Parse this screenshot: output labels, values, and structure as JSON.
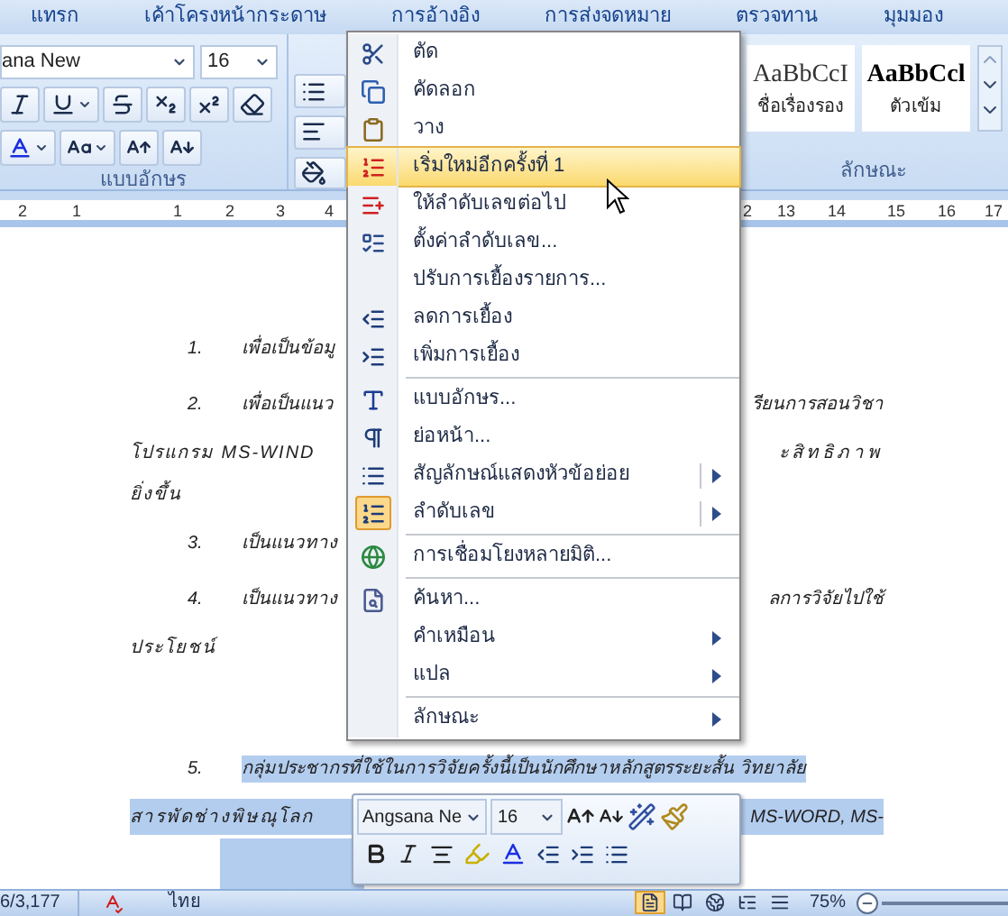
{
  "tabs": [
    {
      "label": "แทรก",
      "selected": false
    },
    {
      "label": "เค้าโครงหน้ากระดาษ",
      "selected": false
    },
    {
      "label": "การอ้างอิง",
      "selected": false
    },
    {
      "label": "การส่งจดหมาย",
      "selected": false
    },
    {
      "label": "ตรวจทาน",
      "selected": false
    },
    {
      "label": "มุมมอง",
      "selected": false
    }
  ],
  "ribbon": {
    "font_name": "ana New",
    "font_size": "16",
    "font_group_label": "แบบอักษร",
    "styles_group_label": "ลักษณะ",
    "style_samples": [
      {
        "sample": "AaBbCcI",
        "name": "ชื่อเรื่องรอง"
      },
      {
        "sample": "AaBbCcl",
        "name": "ตัวเข้ม"
      }
    ]
  },
  "ruler": {
    "left_labels": [
      "2",
      "1",
      "1",
      "2",
      "3",
      "4"
    ],
    "right_labels": [
      "2",
      "13",
      "14",
      "15",
      "16",
      "17"
    ]
  },
  "document": {
    "lines": [
      {
        "kind": "numbered",
        "number": "1.",
        "left": "เพื่อเป็นข้อมู",
        "selected": false
      },
      {
        "kind": "numbered",
        "number": "2.",
        "left": "เพื่อเป็นแนว",
        "right": "รียนการสอนวิชา",
        "selected": false
      },
      {
        "kind": "continuation",
        "left": "โปรแกรม MS-WIND",
        "right": "ะสิทธิภาพ",
        "selected": false
      },
      {
        "kind": "continuation",
        "left": "ยิ่งขึ้น",
        "selected": false
      },
      {
        "kind": "numbered",
        "number": "3.",
        "left": "เป็นแนวทาง",
        "selected": false
      },
      {
        "kind": "numbered",
        "number": "4.",
        "left": "เป็นแนวทาง",
        "right": "ลการวิจัยไปใช้",
        "selected": false
      },
      {
        "kind": "continuation",
        "left": "ประโยชน์",
        "selected": false
      },
      {
        "kind": "numbered",
        "number": "5.",
        "left": "กลุ่มประชากรที่ใช้ในการวิจัยครั้งนี้เป็นนักศึกษาหลักสูตรระยะสั้น วิทยาลัย",
        "selected": true
      },
      {
        "kind": "continuation",
        "left": "สารพัดช่างพิษณุโลก",
        "right": "MS-WORD,  MS-",
        "selected": true
      }
    ]
  },
  "context_menu": [
    {
      "kind": "item",
      "label": "ตัด",
      "highlighted": false,
      "checked": false,
      "submenu": false
    },
    {
      "kind": "item",
      "label": "คัดลอก",
      "highlighted": false,
      "checked": false,
      "submenu": false
    },
    {
      "kind": "item",
      "label": "วาง",
      "highlighted": false,
      "checked": false,
      "submenu": false
    },
    {
      "kind": "item",
      "label": "เริ่มใหม่อีกครั้งที่ 1",
      "highlighted": true,
      "checked": false,
      "submenu": false
    },
    {
      "kind": "item",
      "label": "ให้ลำดับเลขต่อไป",
      "highlighted": false,
      "checked": false,
      "submenu": false
    },
    {
      "kind": "item",
      "label": "ตั้งค่าลำดับเลข...",
      "highlighted": false,
      "checked": false,
      "submenu": false
    },
    {
      "kind": "item",
      "label": "ปรับการเยื้องรายการ...",
      "highlighted": false,
      "checked": false,
      "submenu": false
    },
    {
      "kind": "item",
      "label": "ลดการเยื้อง",
      "highlighted": false,
      "checked": false,
      "submenu": false
    },
    {
      "kind": "item",
      "label": "เพิ่มการเยื้อง",
      "highlighted": false,
      "checked": false,
      "submenu": false
    },
    {
      "kind": "separator"
    },
    {
      "kind": "item",
      "label": "แบบอักษร...",
      "highlighted": false,
      "checked": false,
      "submenu": false
    },
    {
      "kind": "item",
      "label": "ย่อหน้า...",
      "highlighted": false,
      "checked": false,
      "submenu": false
    },
    {
      "kind": "item",
      "label": "สัญลักษณ์แสดงหัวข้อย่อย",
      "highlighted": false,
      "checked": false,
      "submenu": true
    },
    {
      "kind": "item",
      "label": "ลำดับเลข",
      "highlighted": false,
      "checked": true,
      "submenu": true
    },
    {
      "kind": "separator"
    },
    {
      "kind": "item",
      "label": "การเชื่อมโยงหลายมิติ...",
      "highlighted": false,
      "checked": false,
      "submenu": false
    },
    {
      "kind": "separator"
    },
    {
      "kind": "item",
      "label": "ค้นหา...",
      "highlighted": false,
      "checked": false,
      "submenu": false
    },
    {
      "kind": "item",
      "label": "คำเหมือน",
      "highlighted": false,
      "checked": false,
      "submenu": true
    },
    {
      "kind": "item",
      "label": "แปล",
      "highlighted": false,
      "checked": false,
      "submenu": true
    },
    {
      "kind": "separator"
    },
    {
      "kind": "item",
      "label": "ลักษณะ",
      "highlighted": false,
      "checked": false,
      "submenu": true
    }
  ],
  "mini_toolbar": {
    "font_name": "Angsana Ne",
    "font_size": "16"
  },
  "status_bar": {
    "page": "6/3,177",
    "language": "ไทย",
    "zoom": "75%",
    "views": [
      {
        "selected": true
      },
      {
        "selected": false
      },
      {
        "selected": false
      },
      {
        "selected": false
      },
      {
        "selected": false
      }
    ]
  }
}
